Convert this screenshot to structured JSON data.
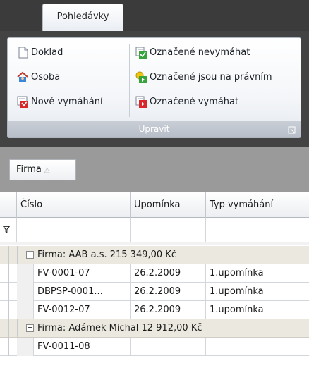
{
  "ribbon": {
    "tab_label": "Pohledávky",
    "group_label": "Upravit",
    "left_items": [
      {
        "label": "Doklad",
        "icon": "document-icon"
      },
      {
        "label": "Osoba",
        "icon": "person-house-icon"
      },
      {
        "label": "Nové vymáhání",
        "icon": "new-collection-icon"
      }
    ],
    "right_items": [
      {
        "label": "Označené nevymáhat",
        "icon": "mark-do-not-collect-icon"
      },
      {
        "label": "Označené jsou na právním",
        "icon": "mark-legal-icon"
      },
      {
        "label": "Označené vymáhat",
        "icon": "mark-collect-icon"
      }
    ]
  },
  "grid": {
    "groupby_chip": "Firma",
    "columns": [
      "Číslo",
      "Upomínka",
      "Typ vymáhání"
    ],
    "groups": [
      {
        "label": "Firma: AAB a.s. 215 349,00 Kč",
        "rows": [
          [
            "FV-0001-07",
            "26.2.2009",
            "1.upomínka"
          ],
          [
            "DBPSP-0001...",
            "26.2.2009",
            "1.upomínka"
          ],
          [
            "FV-0012-07",
            "26.2.2009",
            "1.upomínka"
          ]
        ]
      },
      {
        "label": "Firma: Adámek Michal 12 912,00 Kč",
        "rows": [
          [
            "FV-0011-08",
            "",
            ""
          ]
        ]
      }
    ]
  },
  "colors": {
    "ribbon_dark": "#3b3b3b",
    "group_row": "#ebe9df",
    "groupby_panel": "#9a9a9a"
  }
}
